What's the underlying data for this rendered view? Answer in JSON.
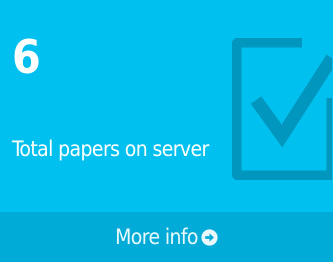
{
  "stat": {
    "value": "6",
    "label": "Total papers on server"
  },
  "icons": {
    "background": "check-square-icon",
    "footer": "arrow-circle-right-icon"
  },
  "footer": {
    "link_label": "More info"
  },
  "colors": {
    "box_background": "#00c0ef",
    "footer_background": "#00acd7",
    "icon_color": "#0096bd",
    "text": "#ffffff"
  }
}
